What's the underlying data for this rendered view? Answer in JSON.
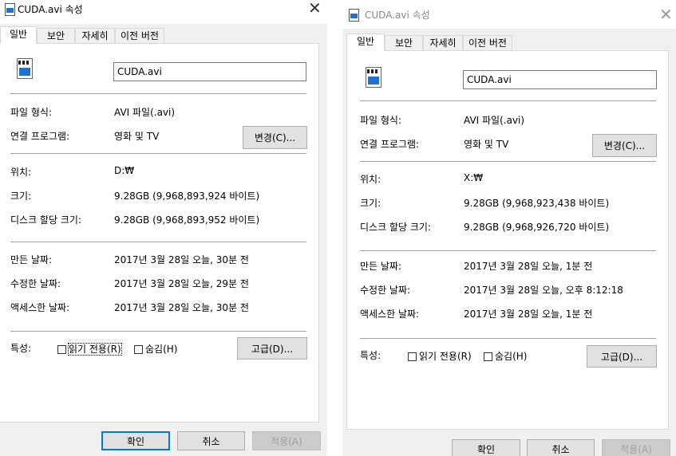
{
  "windows": [
    {
      "title": "CUDA.avi 속성",
      "close_glyph": "✕",
      "tabs": [
        "일반",
        "보안",
        "자세히",
        "이전 버전"
      ],
      "filename": "CUDA.avi",
      "rows": {
        "type_label": "파일 형식:",
        "type_value": "AVI 파일(.avi)",
        "opens_label": "연결 프로그램:",
        "opens_value": "영화 및 TV",
        "change_button": "변경(C)...",
        "location_label": "위치:",
        "location_value": "D:₩",
        "size_label": "크기:",
        "size_value": "9.28GB (9,968,893,924 바이트)",
        "disk_label": "디스크 할당 크기:",
        "disk_value": "9.28GB (9,968,893,952 바이트)",
        "created_label": "만든 날짜:",
        "created_value": "2017년 3월 28일 오늘, 30분 전",
        "modified_label": "수정한 날짜:",
        "modified_value": "2017년 3월 28일 오늘, 29분 전",
        "accessed_label": "액세스한 날짜:",
        "accessed_value": "2017년 3월 28일 오늘, 30분 전",
        "attr_label": "특성:",
        "readonly_label": "읽기 전용(R)",
        "hidden_label": "숨김(H)",
        "advanced_button": "고급(D)..."
      },
      "footer": {
        "ok": "확인",
        "cancel": "취소",
        "apply": "적용(A)"
      }
    },
    {
      "title": "CUDA.avi 속성",
      "close_glyph": "✕",
      "tabs": [
        "일반",
        "보안",
        "자세히",
        "이전 버전"
      ],
      "filename": "CUDA.avi",
      "rows": {
        "type_label": "파일 형식:",
        "type_value": "AVI 파일(.avi)",
        "opens_label": "연결 프로그램:",
        "opens_value": "영화 및 TV",
        "change_button": "변경(C)...",
        "location_label": "위치:",
        "location_value": "X:₩",
        "size_label": "크기:",
        "size_value": "9.28GB (9,968,923,438 바이트)",
        "disk_label": "디스크 할당 크기:",
        "disk_value": "9.28GB (9,968,926,720 바이트)",
        "created_label": "만든 날짜:",
        "created_value": "2017년 3월 28일 오늘, 1분 전",
        "modified_label": "수정한 날짜:",
        "modified_value": "2017년 3월 28일 오늘, 오후 8:12:18",
        "accessed_label": "액세스한 날짜:",
        "accessed_value": "2017년 3월 28일 오늘, 1분 전",
        "attr_label": "특성:",
        "readonly_label": "읽기 전용(R)",
        "hidden_label": "숨김(H)",
        "advanced_button": "고급(D)..."
      },
      "footer": {
        "ok": "확인",
        "cancel": "취소",
        "apply": "적용(A)"
      }
    }
  ]
}
